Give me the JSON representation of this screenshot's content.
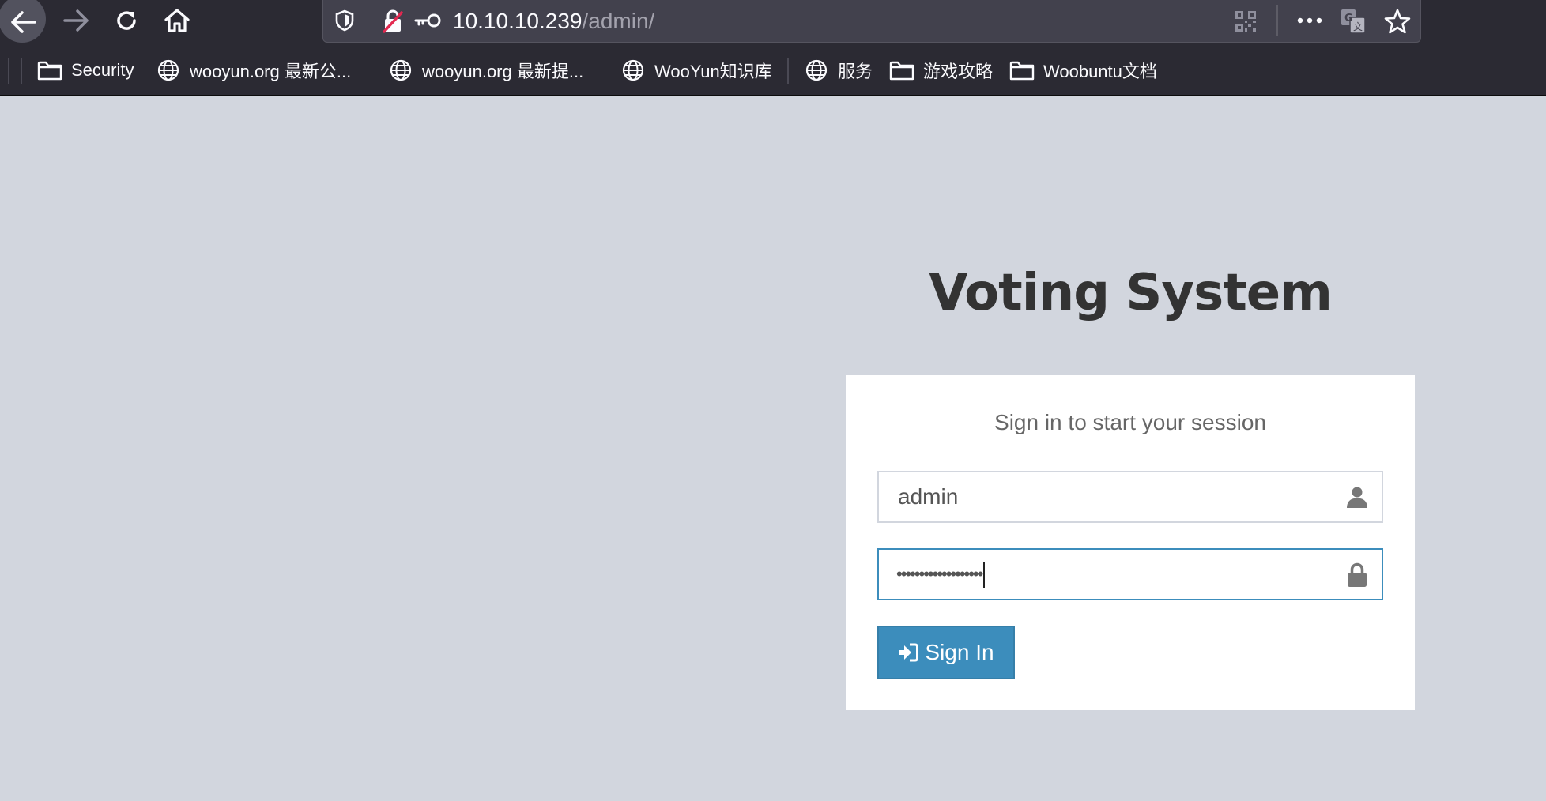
{
  "browser": {
    "url_host": "10.10.10.239",
    "url_path": "/admin/"
  },
  "bookmarks": [
    {
      "label": "Security",
      "icon": "folder-icon"
    },
    {
      "label": "wooyun.org 最新公...",
      "icon": "globe-icon"
    },
    {
      "label": "wooyun.org 最新提...",
      "icon": "globe-icon"
    },
    {
      "label": "WooYun知识库",
      "icon": "globe-icon"
    },
    {
      "label": "服务",
      "icon": "globe-icon"
    },
    {
      "label": "游戏攻略",
      "icon": "folder-icon"
    },
    {
      "label": "Woobuntu文档",
      "icon": "folder-icon"
    }
  ],
  "login": {
    "logo": "Voting System",
    "message": "Sign in to start your session",
    "username_value": "admin",
    "password_value": "•••••••••••••••••••",
    "signin_label": "Sign In"
  },
  "colors": {
    "page_bg": "#d2d6de",
    "primary": "#3c8dbc",
    "toolbar_bg": "#2b2a33"
  }
}
